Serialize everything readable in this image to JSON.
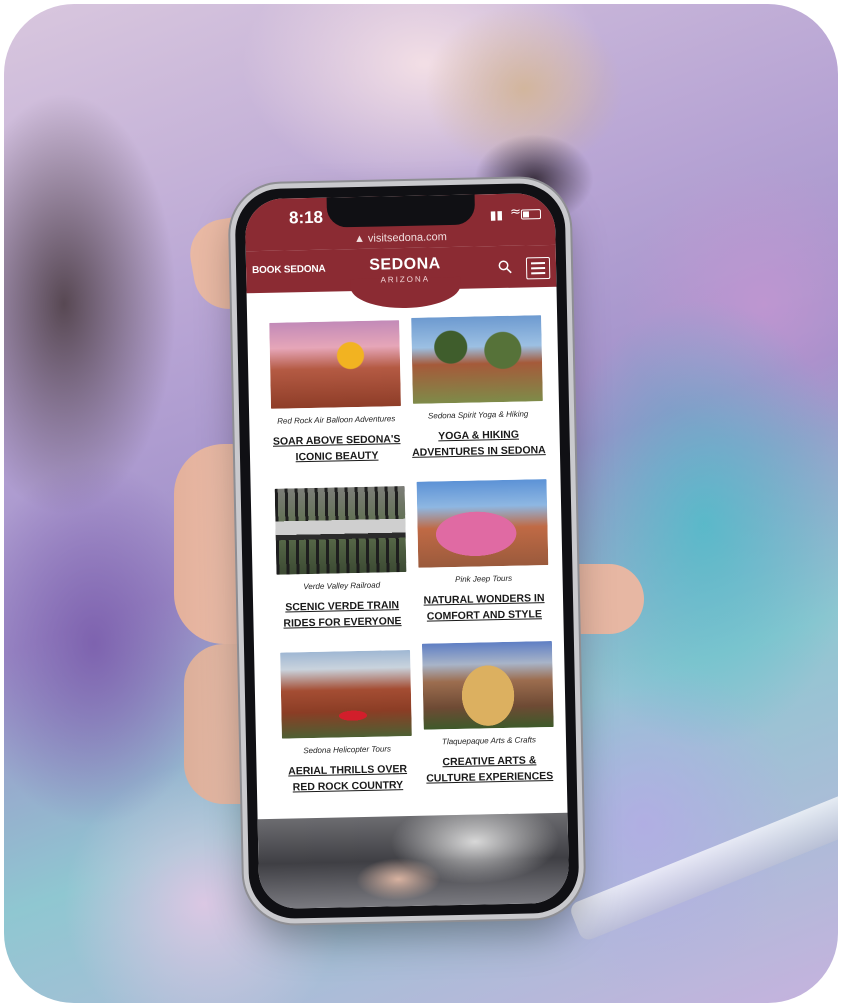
{
  "status_bar": {
    "time": "8:18",
    "url": "visitsedona.com"
  },
  "header": {
    "book_label": "BOOK SEDONA",
    "brand_name": "SEDONA",
    "brand_sub": "ARIZONA",
    "brand_color": "#8b2b33"
  },
  "cards": [
    {
      "caption": "Red Rock Air Balloon Adventures",
      "headline": "SOAR ABOVE SEDONA'S ICONIC BEAUTY"
    },
    {
      "caption": "Sedona Spirit Yoga & Hiking",
      "headline": "YOGA & HIKING ADVENTURES IN SEDONA"
    },
    {
      "caption": "Verde Valley Railroad",
      "headline": "SCENIC VERDE TRAIN RIDES FOR EVERYONE"
    },
    {
      "caption": "Pink Jeep Tours",
      "headline": "NATURAL WONDERS IN COMFORT AND STYLE"
    },
    {
      "caption": "Sedona Helicopter Tours",
      "headline": "AERIAL THRILLS OVER RED ROCK COUNTRY"
    },
    {
      "caption": "Tlaquepaque Arts & Crafts",
      "headline": "CREATIVE ARTS & CULTURE EXPERIENCES"
    }
  ]
}
